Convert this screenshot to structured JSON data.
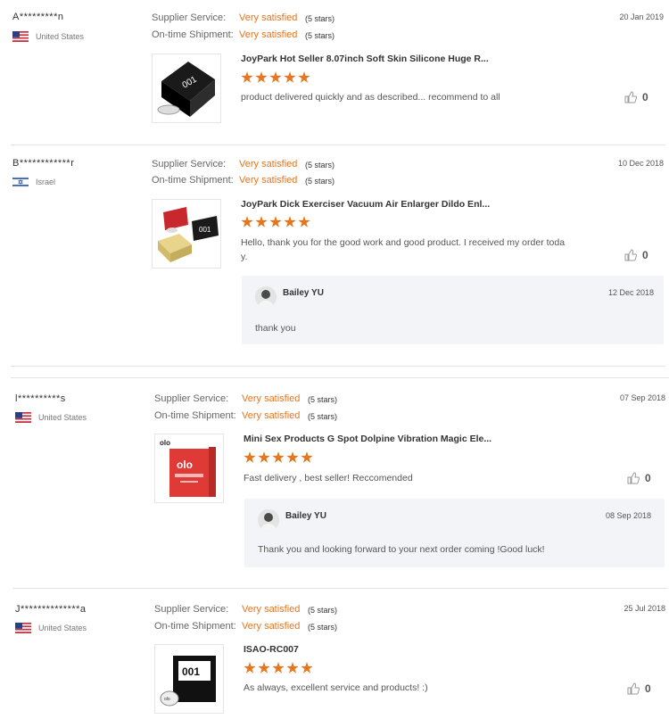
{
  "labels": {
    "supplier_service": "Supplier Service:",
    "ontime_shipment": "On-time Shipment:",
    "stars_suffix": "(5 stars)"
  },
  "colors": {
    "accent": "#e8741b",
    "reply_bg": "#f2f4f7"
  },
  "reviews": [
    {
      "buyer": "A*********n",
      "country": "United States",
      "flag": "us-flag",
      "supplier_service": "Very satisfied",
      "supplier_stars": "(5 stars)",
      "shipment": "Very satisfied",
      "shipment_stars": "(5 stars)",
      "date": "20 Jan 2019",
      "product": "JoyPark Hot Seller 8.07inch Soft Skin Silicone Huge R...",
      "rating": 5,
      "feedback": "product delivered quickly and as described... recommend to all",
      "likes": "0"
    },
    {
      "buyer": "B************r",
      "country": "Israel",
      "flag": "israel-flag",
      "supplier_service": "Very satisfied",
      "supplier_stars": "(5 stars)",
      "shipment": "Very satisfied",
      "shipment_stars": "(5 stars)",
      "date": "10 Dec 2018",
      "product": "JoyPark Dick Exerciser Vacuum Air Enlarger Dildo Enl...",
      "rating": 5,
      "feedback_line1": "Hello, thank you for the good work and good product. I received my order toda",
      "feedback_line2": "y.",
      "likes": "0",
      "reply": {
        "name": "Bailey YU",
        "date": "12 Dec 2018",
        "text": "thank you"
      }
    },
    {
      "buyer": "l**********s",
      "country": "United States",
      "flag": "us-flag",
      "supplier_service": "Very satisfied",
      "supplier_stars": "(5 stars)",
      "shipment": "Very satisfied",
      "shipment_stars": "(5 stars)",
      "date": "07 Sep 2018",
      "product": "Mini Sex Products G Spot Dolpine Vibration Magic Ele...",
      "rating": 5,
      "feedback": "Fast delivery , best seller! Reccomended",
      "likes": "0",
      "reply": {
        "name": "Bailey YU",
        "date": "08 Sep 2018",
        "text": "Thank you and looking forward to your next order coming !Good luck!"
      }
    },
    {
      "buyer": "J**************a",
      "country": "United States",
      "flag": "us-flag",
      "supplier_service": "Very satisfied",
      "supplier_stars": "(5 stars)",
      "shipment": "Very satisfied",
      "shipment_stars": "(5 stars)",
      "date": "25 Jul 2018",
      "product": "ISAO-RC007",
      "rating": 5,
      "feedback": "As always, excellent service and products! :)",
      "likes": "0"
    }
  ]
}
